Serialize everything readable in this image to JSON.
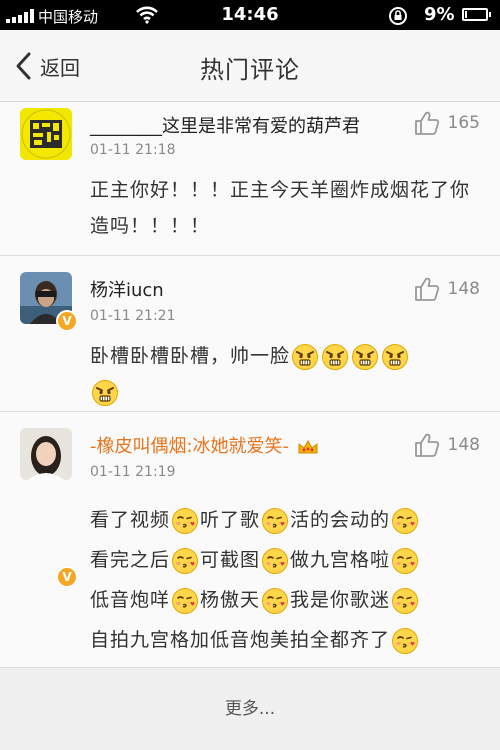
{
  "status_bar": {
    "carrier": "中国移动",
    "time": "14:46",
    "battery_percent": "9%",
    "battery_level": 0.09
  },
  "nav": {
    "back_label": "返回",
    "title": "热门评论"
  },
  "comments": [
    {
      "username": "________这里是非常有爱的葫芦君",
      "time": "01-11 21:18",
      "likes": "165",
      "text": "正主你好！！！正主今天羊圈炸成烟花了你造吗！！！！"
    },
    {
      "username": "杨洋iucn",
      "time": "01-11 21:21",
      "likes": "148",
      "text": "卧槽卧槽卧槽，帅一脸"
    },
    {
      "username": "-橡皮叫偶烟:冰她就爱笑-",
      "time": "01-11 21:19",
      "likes": "148",
      "lines": [
        "看了视频",
        "听了歌",
        "活的会动的",
        "看完之后",
        "可截图",
        "做九宫格啦",
        "低音炮咩",
        "杨傲天",
        "我是你歌迷",
        "自拍九宫格加低音炮美拍全都齐了"
      ]
    }
  ],
  "more_label": "更多...",
  "colors": {
    "vip_name": "#e8741c",
    "verified_badge": "#f5a623",
    "status_bar": "#000000"
  }
}
